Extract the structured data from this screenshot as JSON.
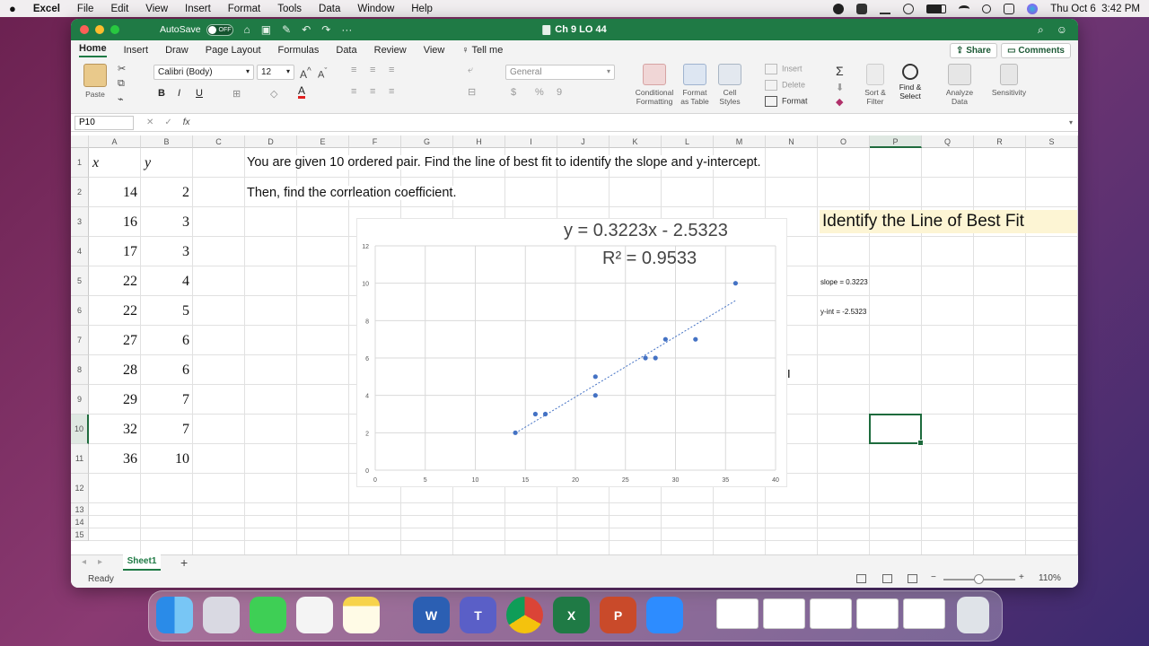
{
  "menubar": {
    "app": "Excel",
    "items": [
      "File",
      "Edit",
      "View",
      "Insert",
      "Format",
      "Tools",
      "Data",
      "Window",
      "Help"
    ],
    "datetime": "Thu Oct 6  3:42 PM"
  },
  "window": {
    "autosave_label": "AutoSave",
    "autosave_state": "OFF",
    "title": "Ch 9 LO 44"
  },
  "ribbon": {
    "tabs": [
      "Home",
      "Insert",
      "Draw",
      "Page Layout",
      "Formulas",
      "Data",
      "Review",
      "View"
    ],
    "tell_me": "Tell me",
    "share": "Share",
    "comments": "Comments",
    "paste": "Paste",
    "font_name": "Calibri (Body)",
    "font_size": "12",
    "number_format": "General",
    "conditional_formatting": "Conditional Formatting",
    "format_as_table": "Format as Table",
    "cell_styles": "Cell Styles",
    "insert": "Insert",
    "delete": "Delete",
    "format": "Format",
    "sort_filter": "Sort & Filter",
    "find_select": "Find & Select",
    "analyze_data": "Analyze Data",
    "sensitivity": "Sensitivity",
    "bold": "B",
    "italic": "I",
    "underline": "U"
  },
  "formula_bar": {
    "name_box": "P10",
    "fx": "fx",
    "cancel": "✕",
    "enter": "✓"
  },
  "grid": {
    "columns": [
      "A",
      "B",
      "C",
      "D",
      "E",
      "F",
      "G",
      "H",
      "I",
      "J",
      "K",
      "L",
      "M",
      "N",
      "O",
      "P",
      "Q",
      "R",
      "S"
    ],
    "rows": [
      "1",
      "2",
      "3",
      "4",
      "5",
      "6",
      "7",
      "8",
      "9",
      "10",
      "11",
      "12",
      "13",
      "14",
      "15"
    ],
    "header_x": "x",
    "header_y": "y",
    "x_values": [
      "14",
      "16",
      "17",
      "22",
      "22",
      "27",
      "28",
      "29",
      "32",
      "36"
    ],
    "y_values": [
      "2",
      "3",
      "3",
      "4",
      "5",
      "6",
      "6",
      "7",
      "7",
      "10"
    ],
    "instruction_1": "You are given 10 ordered pair. Find the line of best fit to identify the slope and y-intercept.",
    "instruction_2": "Then, find the corrleation coefficient.",
    "highlight": "Identify the Line of Best Fit",
    "slope_note": "slope = 0.3223",
    "yint_note": "y-int = -2.5323"
  },
  "chart_data": {
    "type": "scatter",
    "x": [
      14,
      16,
      17,
      22,
      22,
      27,
      28,
      29,
      32,
      36
    ],
    "y": [
      2,
      3,
      3,
      4,
      5,
      6,
      6,
      7,
      7,
      10
    ],
    "trendline": {
      "slope": 0.3223,
      "intercept": -2.5323
    },
    "equation": "y = 0.3223x - 2.5323",
    "r_squared": "R² = 0.9533",
    "xlim": [
      0,
      40
    ],
    "ylim": [
      0,
      12
    ],
    "xticks": [
      "0",
      "5",
      "10",
      "15",
      "20",
      "25",
      "30",
      "35",
      "40"
    ],
    "yticks": [
      "0",
      "2",
      "4",
      "6",
      "8",
      "10",
      "12"
    ],
    "grid": true,
    "color": "#4472c4"
  },
  "sheets": {
    "active": "Sheet1",
    "add": "+"
  },
  "status": {
    "ready": "Ready",
    "zoom": "110%",
    "minus": "−",
    "plus": "+"
  },
  "colors": {
    "excel_green": "#1f7a45",
    "highlight_bg": "#fdf5d4",
    "point": "#4472c4"
  }
}
